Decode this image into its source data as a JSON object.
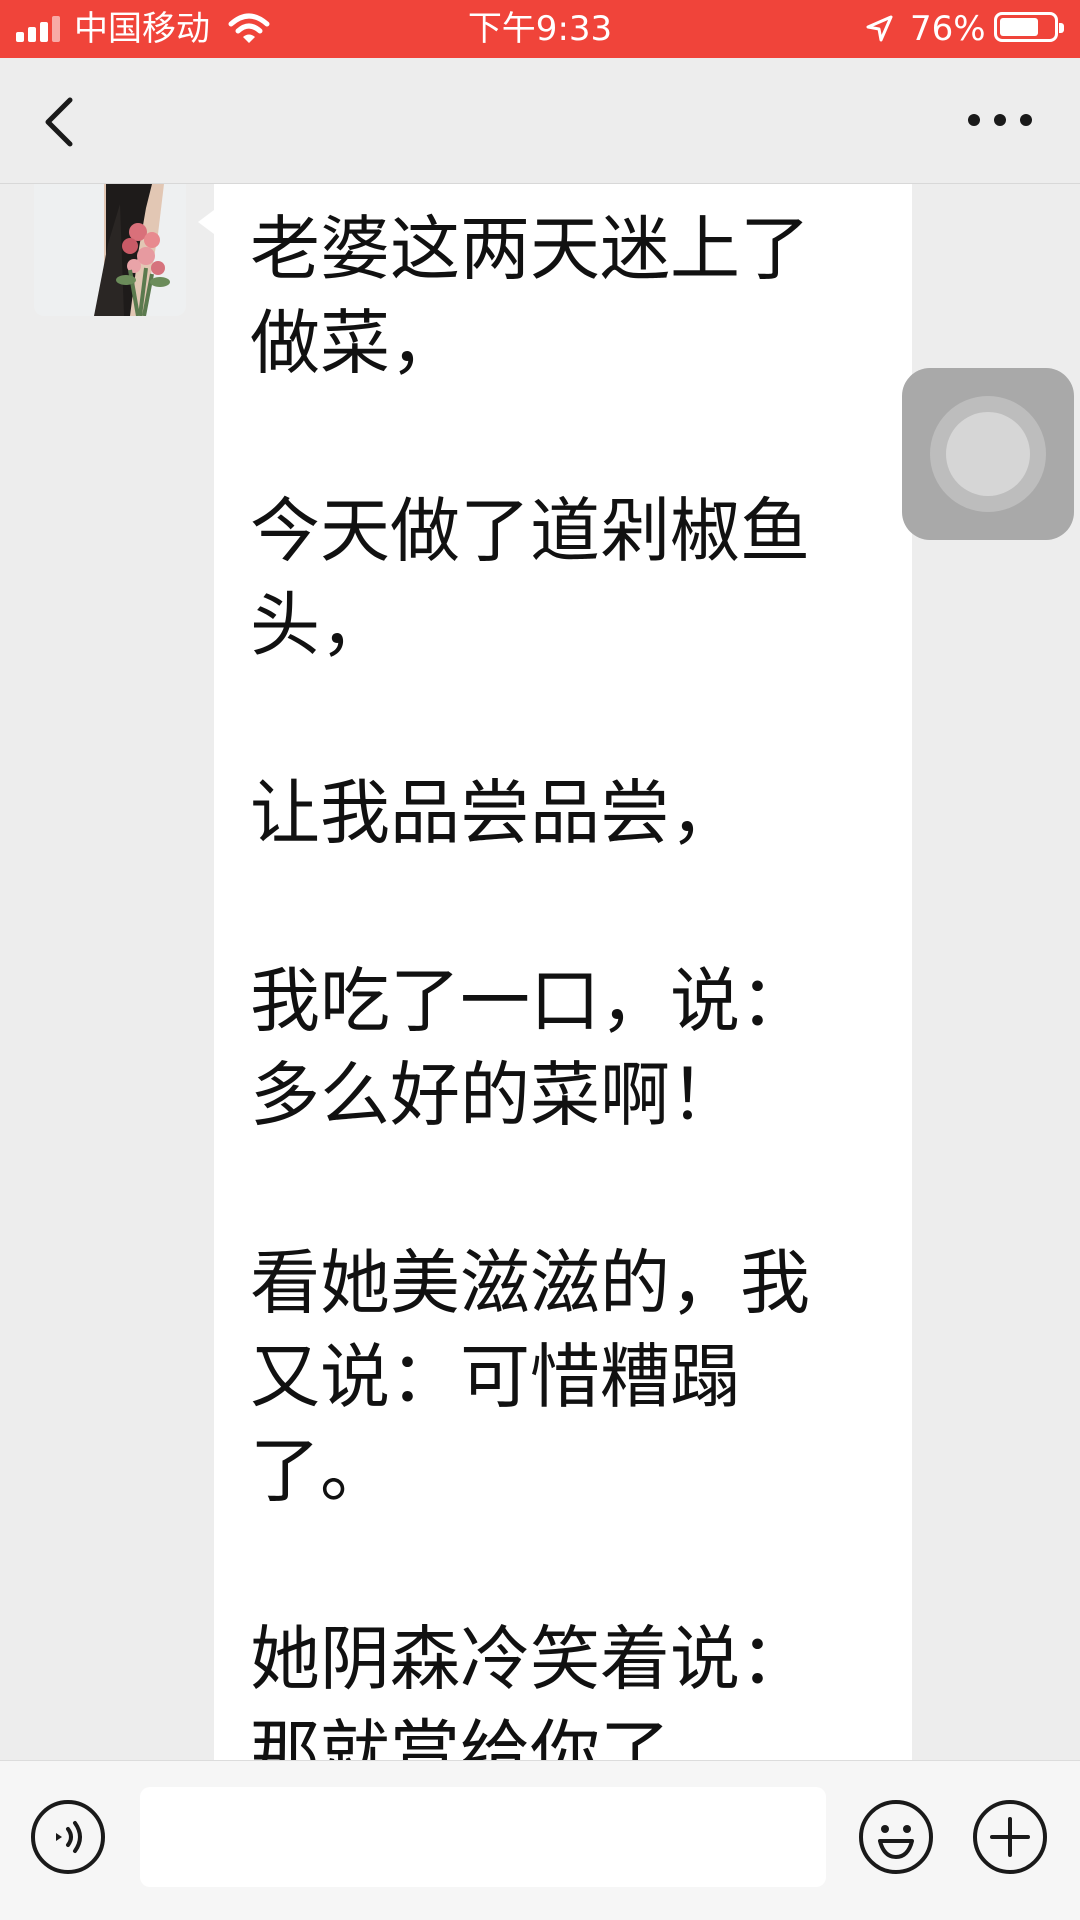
{
  "status_bar": {
    "carrier": "中国移动",
    "time": "下午9:33",
    "battery_percent": "76%",
    "battery_level": 0.76,
    "icons": [
      "signal-icon",
      "wifi-icon",
      "location-arrow-icon",
      "battery-icon"
    ]
  },
  "nav_bar": {
    "icons": [
      "back-chevron-icon",
      "more-dots-icon"
    ]
  },
  "message": {
    "paragraphs": [
      "老婆这两天迷上了做菜，",
      "今天做了道剁椒鱼头，",
      "让我品尝品尝，",
      "我吃了一口，说：多么好的菜啊！",
      "看她美滋滋的，我又说：可惜糟蹋了。",
      "她阴森冷笑着说：那就赏给你了"
    ],
    "bubble_color": "#ffffff"
  },
  "input_bar": {
    "icons": [
      "voice-icon",
      "emoji-icon",
      "plus-icon"
    ]
  },
  "colors": {
    "status_bar_bg": "#f0443a",
    "page_bg": "#ededed"
  }
}
